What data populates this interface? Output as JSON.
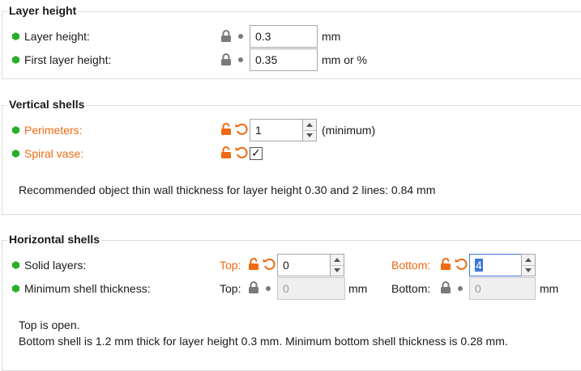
{
  "sections": {
    "layer_height": {
      "title": "Layer height",
      "rows": [
        {
          "label": "Layer height:",
          "value": "0.3",
          "unit": "mm"
        },
        {
          "label": "First layer height:",
          "value": "0.35",
          "unit": "mm or %"
        }
      ]
    },
    "vertical_shells": {
      "title": "Vertical shells",
      "perimeters": {
        "label": "Perimeters:",
        "value": "1",
        "suffix": "(minimum)"
      },
      "spiral_vase": {
        "label": "Spiral vase:",
        "checked": true,
        "check_glyph": "✓"
      },
      "recommendation": "Recommended object thin wall thickness for layer height 0.30 and 2 lines: 0.84 mm"
    },
    "horizontal_shells": {
      "title": "Horizontal shells",
      "solid_layers": {
        "label": "Solid layers:",
        "top_label": "Top:",
        "top_value": "0",
        "bottom_label": "Bottom:",
        "bottom_value": "4"
      },
      "min_shell": {
        "label": "Minimum shell thickness:",
        "top_label": "Top:",
        "top_value": "0",
        "top_unit": "mm",
        "bottom_label": "Bottom:",
        "bottom_value": "0",
        "bottom_unit": "mm"
      },
      "info_line1": "Top is open.",
      "info_line2": "Bottom shell is 1.2 mm thick for layer height 0.3 mm. Minimum bottom shell thickness is 0.28 mm."
    }
  },
  "colors": {
    "accent_orange": "#ef6a12",
    "status_green": "#27b027",
    "lock_gray": "#7a7a7a",
    "selection_blue": "#3b78d8"
  },
  "icons": [
    "lock-icon",
    "unlock-icon",
    "undo-arrow-icon",
    "bullet-icon",
    "checkmark-icon"
  ]
}
